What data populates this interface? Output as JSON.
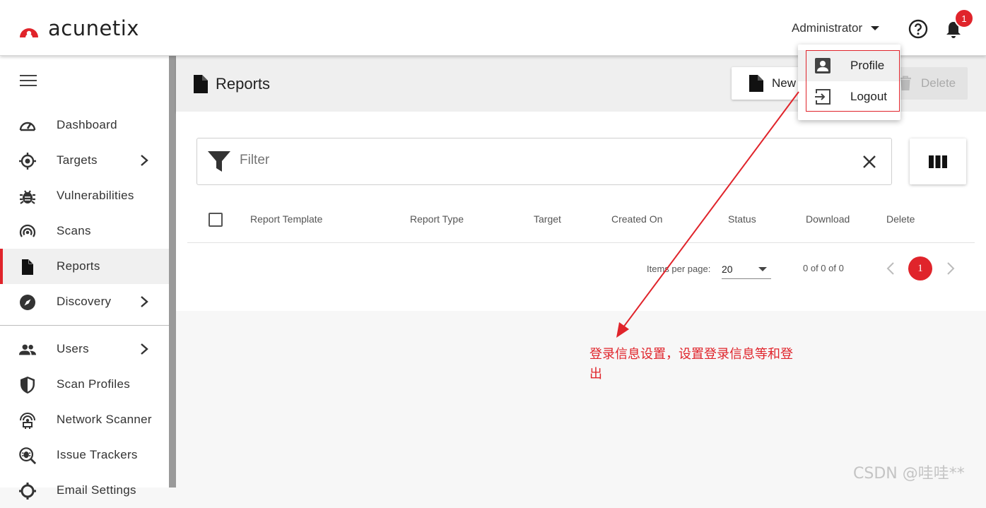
{
  "app": {
    "brand": "acunetix"
  },
  "header": {
    "user_label": "Administrator",
    "notification_count": "1",
    "icons": [
      "help-icon",
      "bell-icon"
    ]
  },
  "user_menu": {
    "items": [
      {
        "label": "Profile",
        "icon": "user-card-icon"
      },
      {
        "label": "Logout",
        "icon": "logout-icon"
      }
    ]
  },
  "sidebar": {
    "items": [
      {
        "label": "Dashboard",
        "icon": "gauge-icon"
      },
      {
        "label": "Targets",
        "icon": "crosshair-icon",
        "has_submenu": true
      },
      {
        "label": "Vulnerabilities",
        "icon": "bug-icon"
      },
      {
        "label": "Scans",
        "icon": "radar-icon"
      },
      {
        "label": "Reports",
        "icon": "document-icon",
        "active": true
      },
      {
        "label": "Discovery",
        "icon": "compass-icon",
        "has_submenu": true
      },
      {
        "label": "Users",
        "icon": "users-icon",
        "has_submenu": true
      },
      {
        "label": "Scan Profiles",
        "icon": "shield-icon"
      },
      {
        "label": "Network Scanner",
        "icon": "network-scanner-icon"
      },
      {
        "label": "Issue Trackers",
        "icon": "issue-tracker-icon"
      },
      {
        "label": "Email Settings",
        "icon": "email-settings-icon"
      }
    ]
  },
  "page": {
    "title": "Reports",
    "new_label": "New",
    "delete_label": "Delete"
  },
  "filter": {
    "placeholder": "Filter"
  },
  "table": {
    "columns": [
      "Report Template",
      "Report Type",
      "Target",
      "Created On",
      "Status",
      "Download",
      "Delete"
    ]
  },
  "pagination": {
    "items_per_page_label": "Items per page:",
    "items_per_page_value": "20",
    "range_text": "0 of 0 of 0",
    "current_page": "1"
  },
  "annotation": {
    "text": "登录信息设置，设置登录信息等和登出",
    "color": "#e0242b"
  },
  "watermark": "CSDN @哇哇**",
  "colors": {
    "accent": "#e0242b",
    "sidebar_border": "#9a9a9a"
  }
}
